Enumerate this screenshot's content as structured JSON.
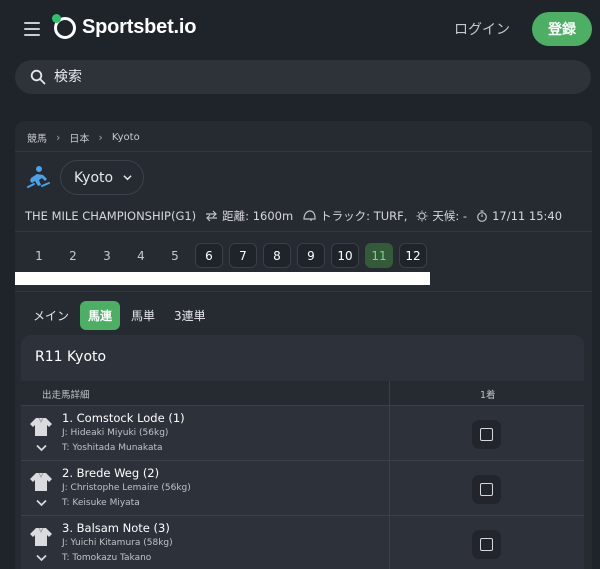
{
  "header": {
    "logo_text": "Sportsbet.io",
    "login_label": "ログイン",
    "register_label": "登録",
    "brand_color": "#4caf64"
  },
  "search": {
    "placeholder": "検索",
    "value": ""
  },
  "breadcrumb": [
    "競馬",
    "日本",
    "Kyoto"
  ],
  "venue": {
    "selected": "Kyoto",
    "icon": "horse-racing-icon"
  },
  "race_info": {
    "name": "THE MILE CHAMPIONSHIP(G1)",
    "distance": "距離: 1600m",
    "track": "トラック: TURF,",
    "weather": "天候: -",
    "time": "17/11 15:40"
  },
  "race_numbers": [
    "1",
    "2",
    "3",
    "4",
    "5",
    "6",
    "7",
    "8",
    "9",
    "10",
    "11",
    "12"
  ],
  "active_race": "11",
  "bet_tabs": [
    "メイン",
    "馬連",
    "馬単",
    "3連単"
  ],
  "active_tab": "馬連",
  "card": {
    "title": "R11 Kyoto",
    "col_runner": "出走馬詳細",
    "col_first": "1着"
  },
  "runners": [
    {
      "name": "1. Comstock Lode (1)",
      "jockey": "J: Hideaki Miyuki (56kg)",
      "trainer": "T: Yoshitada Munakata",
      "checked": false
    },
    {
      "name": "2. Brede Weg (2)",
      "jockey": "J: Christophe Lemaire (56kg)",
      "trainer": "T: Keisuke Miyata",
      "checked": false
    },
    {
      "name": "3. Balsam Note (3)",
      "jockey": "J: Yuichi Kitamura (58kg)",
      "trainer": "T: Tomokazu Takano",
      "checked": false
    }
  ]
}
